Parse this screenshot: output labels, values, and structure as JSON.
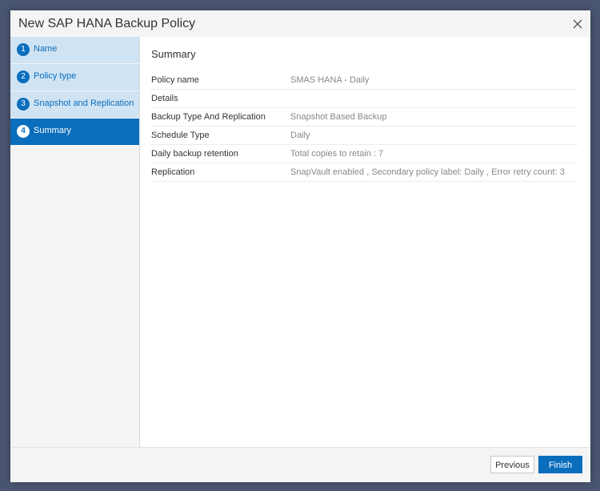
{
  "dialog": {
    "title": "New SAP HANA Backup Policy"
  },
  "steps": [
    {
      "number": "1",
      "label": "Name"
    },
    {
      "number": "2",
      "label": "Policy type"
    },
    {
      "number": "3",
      "label": "Snapshot and Replication"
    },
    {
      "number": "4",
      "label": "Summary"
    }
  ],
  "summary": {
    "title": "Summary",
    "rows": [
      {
        "key": "Policy name",
        "value": "SMAS HANA - Daily"
      },
      {
        "key": "Details",
        "value": ""
      },
      {
        "key": "Backup Type And Replication",
        "value": "Snapshot Based Backup"
      },
      {
        "key": "Schedule Type",
        "value": "Daily"
      },
      {
        "key": "Daily backup retention",
        "value": "Total copies to retain : 7"
      },
      {
        "key": "Replication",
        "value": "SnapVault enabled , Secondary policy label: Daily , Error retry count: 3"
      }
    ]
  },
  "footer": {
    "previous_label": "Previous",
    "finish_label": "Finish"
  },
  "colors": {
    "accent": "#0a6ebd",
    "step_bg": "#cfe3f3",
    "backdrop": "#4a5570"
  }
}
